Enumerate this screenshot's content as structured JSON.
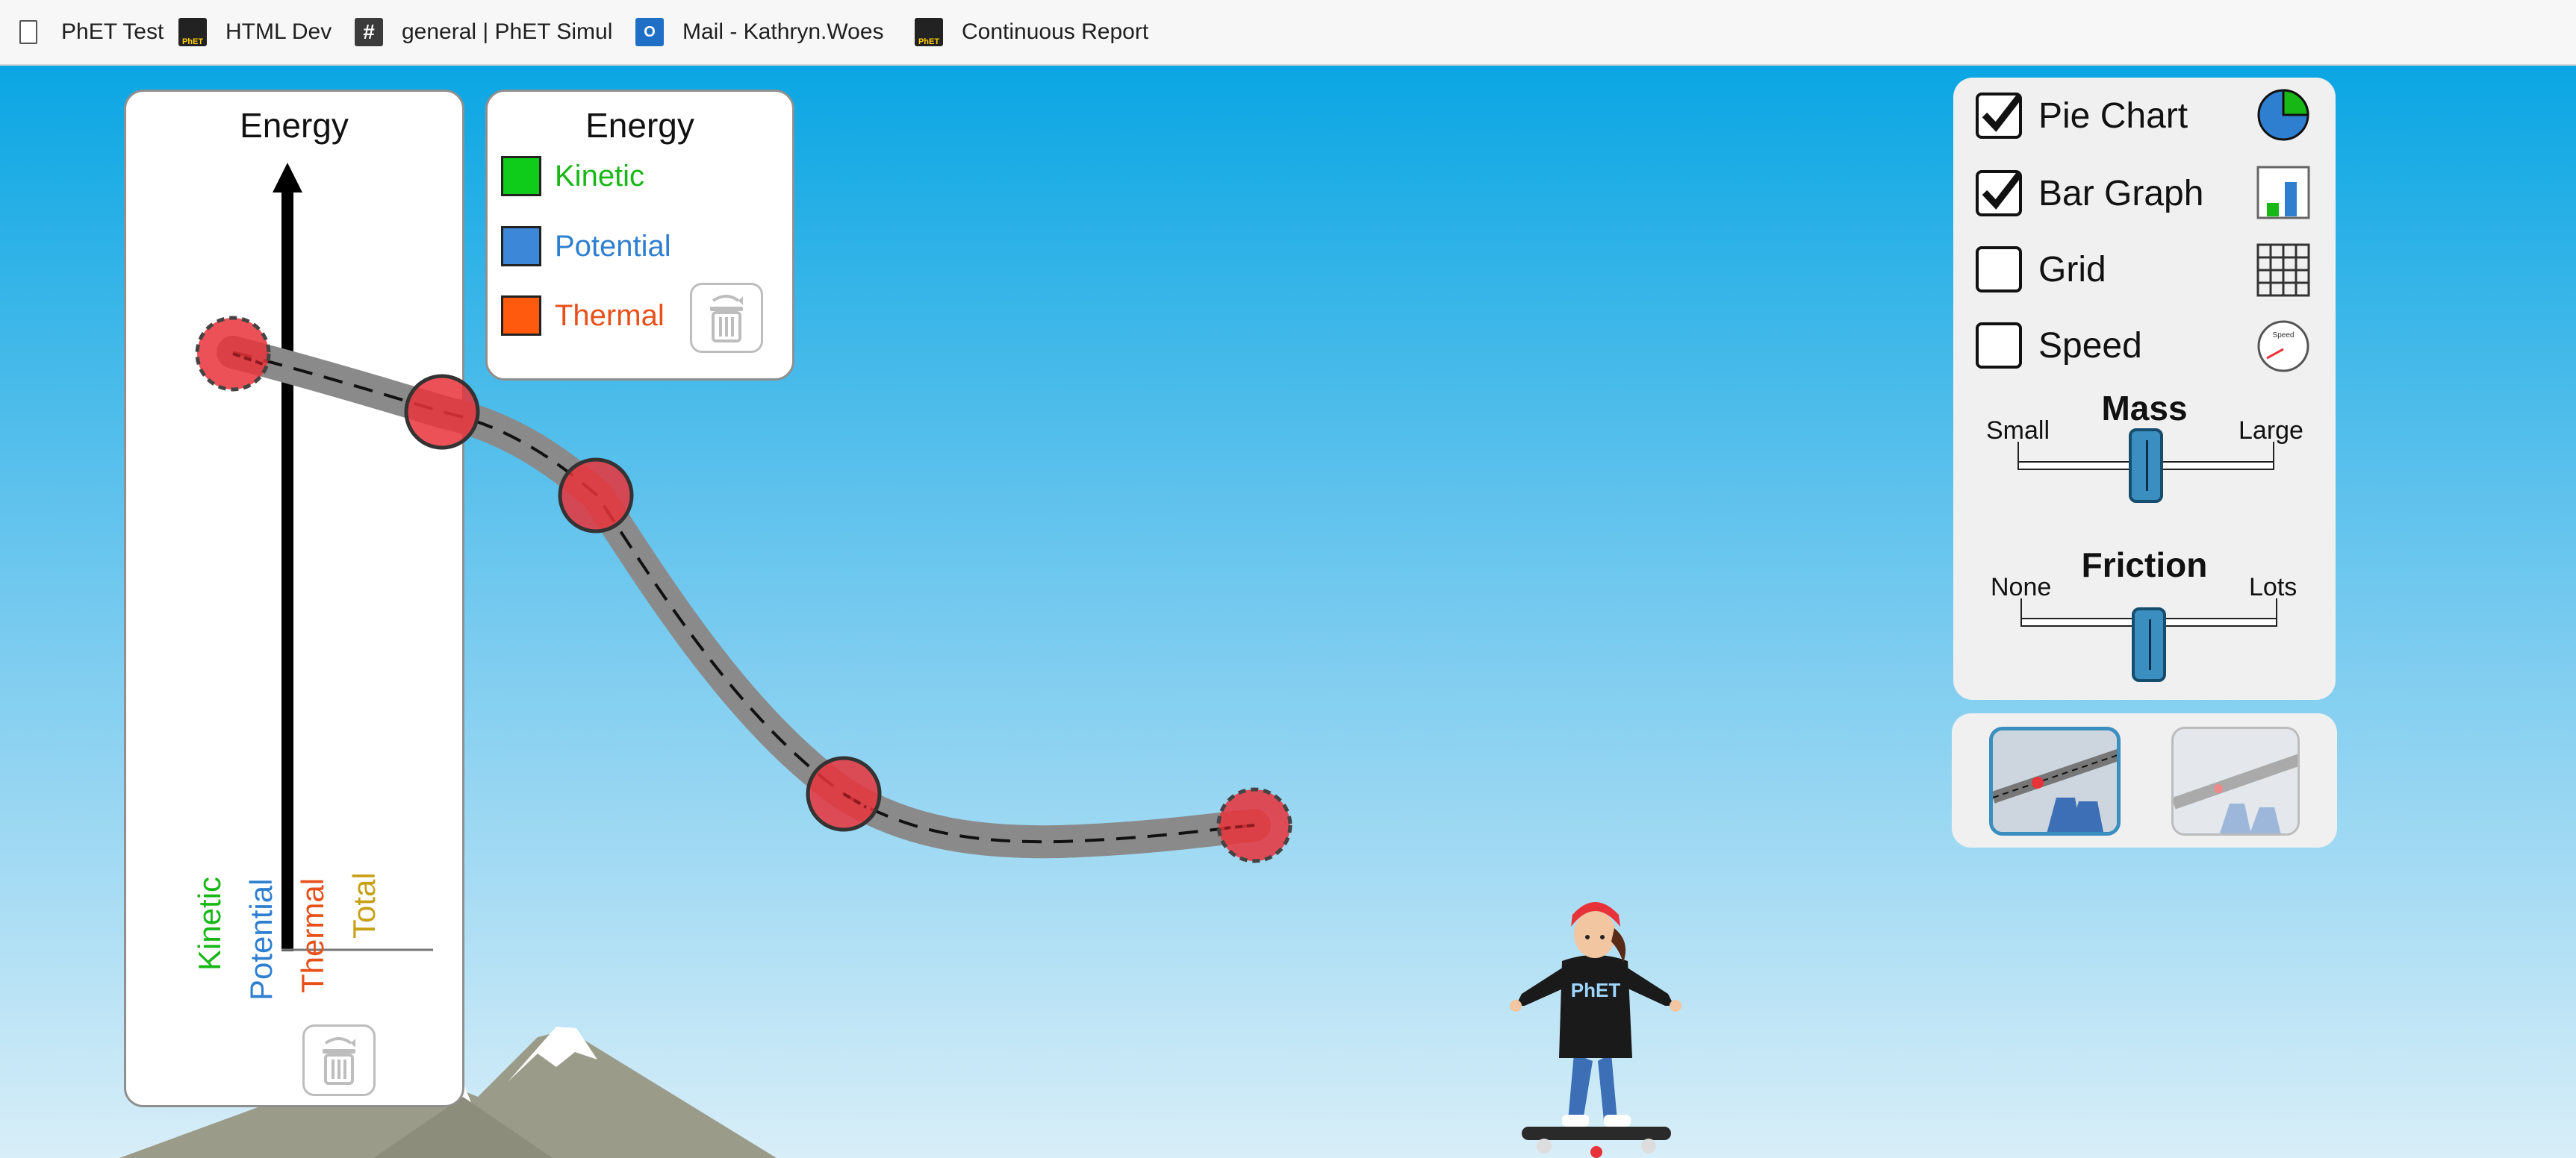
{
  "bookmarks": [
    {
      "label": "PhET Test",
      "icon": "page-icon"
    },
    {
      "label": "HTML Dev",
      "icon": "phet-icon"
    },
    {
      "label": "general | PhET Simul",
      "icon": "slack-icon"
    },
    {
      "label": "Mail - Kathryn.Woes",
      "icon": "outlook-icon"
    },
    {
      "label": "Continuous Report",
      "icon": "phet-icon"
    }
  ],
  "bar_graph": {
    "title": "Energy",
    "bars": [
      {
        "label": "Kinetic",
        "color": "#17b815"
      },
      {
        "label": "Potential",
        "color": "#2f7fd0"
      },
      {
        "label": "Thermal",
        "color": "#e8501a"
      },
      {
        "label": "Total",
        "color": "#c8a016"
      }
    ]
  },
  "legend": {
    "title": "Energy",
    "items": [
      {
        "label": "Kinetic",
        "color": "#17b815",
        "swatch": "#0fcc1a"
      },
      {
        "label": "Potential",
        "color": "#2f7fd0",
        "swatch": "#3d87d8"
      },
      {
        "label": "Thermal",
        "color": "#e8501a",
        "swatch": "#ff5a0d"
      }
    ]
  },
  "controls": {
    "checkboxes": [
      {
        "label": "Pie Chart",
        "checked": true,
        "icon": "pie-chart-icon"
      },
      {
        "label": "Bar Graph",
        "checked": true,
        "icon": "bar-graph-icon"
      },
      {
        "label": "Grid",
        "checked": false,
        "icon": "grid-icon"
      },
      {
        "label": "Speed",
        "checked": false,
        "icon": "speedometer-icon"
      }
    ],
    "speed_icon_text": "Speed",
    "mass": {
      "title": "Mass",
      "min_label": "Small",
      "max_label": "Large",
      "value": 0.5
    },
    "friction": {
      "title": "Friction",
      "min_label": "None",
      "max_label": "Lots",
      "value": 0.5
    }
  },
  "skater": {
    "shirt_text": "PhET"
  },
  "colors": {
    "sky_top": "#0aa6e3",
    "sky_bottom": "#d8eef8",
    "track": "#8a8a8a",
    "control_point": "#e8323a"
  }
}
